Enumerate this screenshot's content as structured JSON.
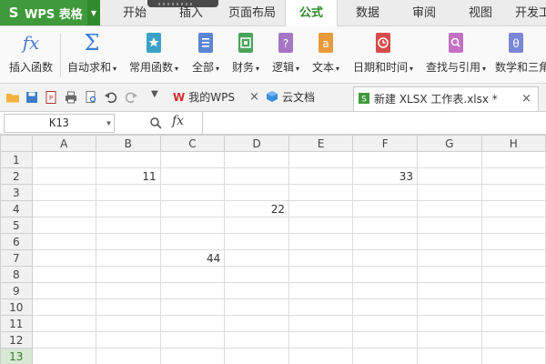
{
  "app": {
    "title": "WPS 表格"
  },
  "menu_tabs": [
    {
      "label": "开始"
    },
    {
      "label": "插入"
    },
    {
      "label": "页面布局"
    },
    {
      "label": "公式"
    },
    {
      "label": "数据"
    },
    {
      "label": "审阅"
    },
    {
      "label": "视图"
    },
    {
      "label": "开发工"
    }
  ],
  "active_tab": "公式",
  "ribbon": [
    {
      "label": "插入函数",
      "dropdown": false,
      "icon": "fx-icon"
    },
    {
      "label": "自动求和",
      "dropdown": true,
      "icon": "sigma-icon"
    },
    {
      "label": "常用函数",
      "dropdown": true,
      "icon": "star-book-icon"
    },
    {
      "label": "全部",
      "dropdown": true,
      "icon": "list-book-icon"
    },
    {
      "label": "财务",
      "dropdown": true,
      "icon": "finance-book-icon"
    },
    {
      "label": "逻辑",
      "dropdown": true,
      "icon": "question-book-icon"
    },
    {
      "label": "文本",
      "dropdown": true,
      "icon": "text-book-icon"
    },
    {
      "label": "日期和时间",
      "dropdown": true,
      "icon": "clock-book-icon"
    },
    {
      "label": "查找与引用",
      "dropdown": true,
      "icon": "search-book-icon"
    },
    {
      "label": "数学和三角",
      "dropdown": false,
      "icon": "theta-book-icon"
    }
  ],
  "ribbon_glyphs": {
    "fx": "fx",
    "sigma": "Σ",
    "question": "?",
    "text": "a",
    "theta": "θ"
  },
  "doc_tabs": [
    {
      "label": "我的WPS",
      "icon": "wps-logo-icon"
    },
    {
      "label": "云文档",
      "icon": "cloud-box-icon"
    },
    {
      "label": "新建 XLSX 工作表.xlsx *",
      "icon": "sheet-file-icon",
      "active": true
    }
  ],
  "formula_bar": {
    "cell_ref": "K13",
    "fx_label": "fx",
    "formula": ""
  },
  "columns": [
    "A",
    "B",
    "C",
    "D",
    "E",
    "F",
    "G",
    "H"
  ],
  "rows": [
    {
      "num": "1",
      "cells": [
        "",
        "",
        "",
        "",
        "",
        "",
        "",
        ""
      ]
    },
    {
      "num": "2",
      "cells": [
        "",
        "11",
        "",
        "",
        "",
        "33",
        "",
        ""
      ]
    },
    {
      "num": "3",
      "cells": [
        "",
        "",
        "",
        "",
        "",
        "",
        "",
        ""
      ]
    },
    {
      "num": "4",
      "cells": [
        "",
        "",
        "",
        "22",
        "",
        "",
        "",
        ""
      ]
    },
    {
      "num": "5",
      "cells": [
        "",
        "",
        "",
        "",
        "",
        "",
        "",
        ""
      ]
    },
    {
      "num": "6",
      "cells": [
        "",
        "",
        "",
        "",
        "",
        "",
        "",
        ""
      ]
    },
    {
      "num": "7",
      "cells": [
        "",
        "",
        "44",
        "",
        "",
        "",
        "",
        ""
      ]
    },
    {
      "num": "8",
      "cells": [
        "",
        "",
        "",
        "",
        "",
        "",
        "",
        ""
      ]
    },
    {
      "num": "9",
      "cells": [
        "",
        "",
        "",
        "",
        "",
        "",
        "",
        ""
      ]
    },
    {
      "num": "10",
      "cells": [
        "",
        "",
        "",
        "",
        "",
        "",
        "",
        ""
      ]
    },
    {
      "num": "11",
      "cells": [
        "",
        "",
        "",
        "",
        "",
        "",
        "",
        ""
      ]
    },
    {
      "num": "12",
      "cells": [
        "",
        "",
        "",
        "",
        "",
        "",
        "",
        ""
      ]
    },
    {
      "num": "13",
      "cells": [
        "",
        "",
        "",
        "",
        "",
        "",
        "",
        ""
      ]
    }
  ],
  "selected_row": "13",
  "colors": {
    "brand": "#3e9a3a",
    "active_tab_text": "#2f8a2c"
  }
}
